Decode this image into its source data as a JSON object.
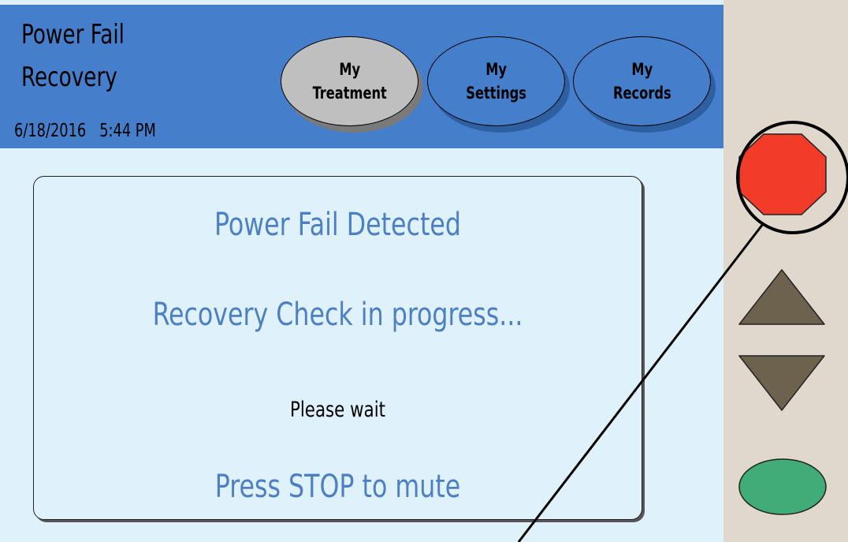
{
  "header": {
    "title_line1": "Power Fail",
    "title_line2": "Recovery",
    "date": "6/18/2016",
    "time": "5:44 PM"
  },
  "nav": [
    {
      "label": "My\nTreatment",
      "active": true
    },
    {
      "label": "My\nSettings",
      "active": false
    },
    {
      "label": "My\nRecords",
      "active": false
    }
  ],
  "message": {
    "line1": "Power Fail Detected",
    "line2": "Recovery Check in progress...",
    "line3": "Please wait",
    "line4": "Press STOP to mute"
  },
  "hardware_buttons": [
    {
      "name": "stop-button",
      "shape": "octagon",
      "color": "#f23c28"
    },
    {
      "name": "up-arrow-button",
      "shape": "triangle-up",
      "color": "#6d624d"
    },
    {
      "name": "down-arrow-button",
      "shape": "triangle-down",
      "color": "#6d624d"
    },
    {
      "name": "enter-button",
      "shape": "oval",
      "color": "#41ac77"
    }
  ],
  "colors": {
    "header_bg": "#457ecb",
    "screen_bg": "#dff2fc",
    "message_text": "#4d7fc3",
    "rail_bg": "#e0d8cc"
  }
}
